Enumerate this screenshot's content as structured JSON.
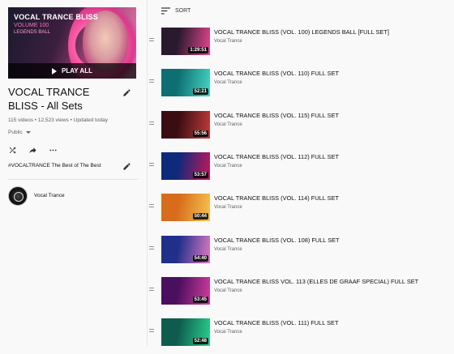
{
  "playlist": {
    "thumb_title": "VOCAL TRANCE BLISS",
    "thumb_volume": "VOLUME 100",
    "thumb_subtitle": "LEGENDS BALL",
    "play_all_label": "PLAY ALL",
    "title": "VOCAL TRANCE BLISS - All Sets",
    "stats": "115 videos • 12,523 views • Updated today",
    "privacy": "Public",
    "description": "#VOCALTRANCE The Best of The Best",
    "owner": "Vocal Trance"
  },
  "sort_label": "SORT",
  "videos": [
    {
      "title": "VOCAL TRANCE BLISS (VOL. 100) LEGENDS BALL [FULL SET]",
      "channel": "Vocal Trance",
      "duration": "1:29:51",
      "colors": [
        "#2a1a2e",
        "#e3478f"
      ]
    },
    {
      "title": "VOCAL TRANCE BLISS (VOL. 110) FULL SET",
      "channel": "Vocal Trance",
      "duration": "52:21",
      "colors": [
        "#0e6f72",
        "#46d6c4"
      ]
    },
    {
      "title": "VOCAL TRANCE BLISS (VOL. 115) FULL SET",
      "channel": "Vocal Trance",
      "duration": "55:56",
      "colors": [
        "#3a0d12",
        "#c43b3b"
      ]
    },
    {
      "title": "VOCAL TRANCE BLISS (VOL. 112) FULL SET",
      "channel": "Vocal Trance",
      "duration": "53:57",
      "colors": [
        "#0e2a7a",
        "#c2185b"
      ]
    },
    {
      "title": "VOCAL TRANCE BLISS (VOL. 114) FULL SET",
      "channel": "Vocal Trance",
      "duration": "50:44",
      "colors": [
        "#d86c1a",
        "#f6c453"
      ]
    },
    {
      "title": "VOCAL TRANCE BLISS (VOL. 108) FULL SET",
      "channel": "Vocal Trance",
      "duration": "54:40",
      "colors": [
        "#1f2f8a",
        "#e07ac4"
      ]
    },
    {
      "title": "VOCAL TRANCE BLISS VOL. 113 (ELLES DE GRAAF SPECIAL) FULL SET",
      "channel": "Vocal Trance",
      "duration": "53:45",
      "colors": [
        "#4a0f5e",
        "#d43ca0"
      ]
    },
    {
      "title": "VOCAL TRANCE BLISS (VOL. 111) FULL SET",
      "channel": "Vocal Trance",
      "duration": "52:48",
      "colors": [
        "#0d5c4e",
        "#2bd18e"
      ]
    }
  ]
}
